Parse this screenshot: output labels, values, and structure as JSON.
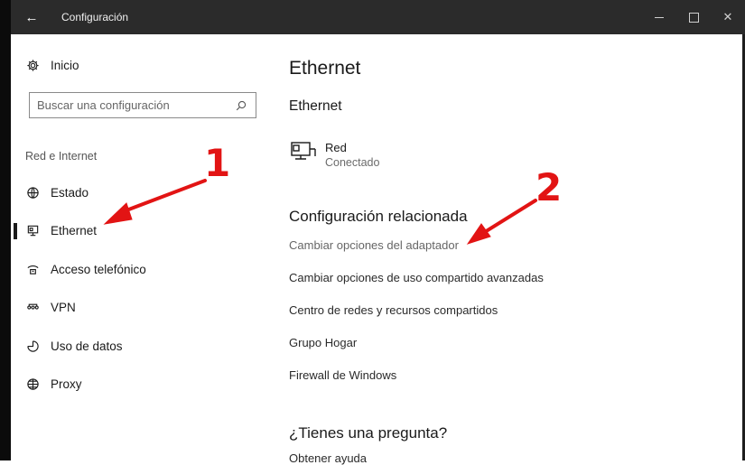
{
  "window": {
    "title": "Configuración",
    "back_glyph": "←",
    "close_glyph": "✕"
  },
  "sidebar": {
    "home_label": "Inicio",
    "search_placeholder": "Buscar una configuración",
    "section_label": "Red e Internet",
    "items": [
      {
        "label": "Estado",
        "icon": "status-globe-icon"
      },
      {
        "label": "Ethernet",
        "icon": "ethernet-monitor-icon",
        "active": true
      },
      {
        "label": "Acceso telefónico",
        "icon": "dial-up-phone-icon"
      },
      {
        "label": "VPN",
        "icon": "vpn-icon"
      },
      {
        "label": "Uso de datos",
        "icon": "data-usage-icon"
      },
      {
        "label": "Proxy",
        "icon": "proxy-globe-icon"
      }
    ]
  },
  "main": {
    "title": "Ethernet",
    "subtitle": "Ethernet",
    "network": {
      "name": "Red",
      "status": "Conectado",
      "icon": "network-monitor-icon"
    },
    "related_title": "Configuración relacionada",
    "related_links": [
      "Cambiar opciones del adaptador",
      "Cambiar opciones de uso compartido avanzadas",
      "Centro de redes y recursos compartidos",
      "Grupo Hogar",
      "Firewall de Windows"
    ],
    "question_title": "¿Tienes una pregunta?",
    "help_link": "Obtener ayuda"
  },
  "annotations": {
    "marker_1": "1",
    "marker_2": "2",
    "color": "#e21414"
  },
  "colors": {
    "titlebar": "#2b2b2b",
    "text": "#1a1a1a",
    "muted": "#666666"
  }
}
